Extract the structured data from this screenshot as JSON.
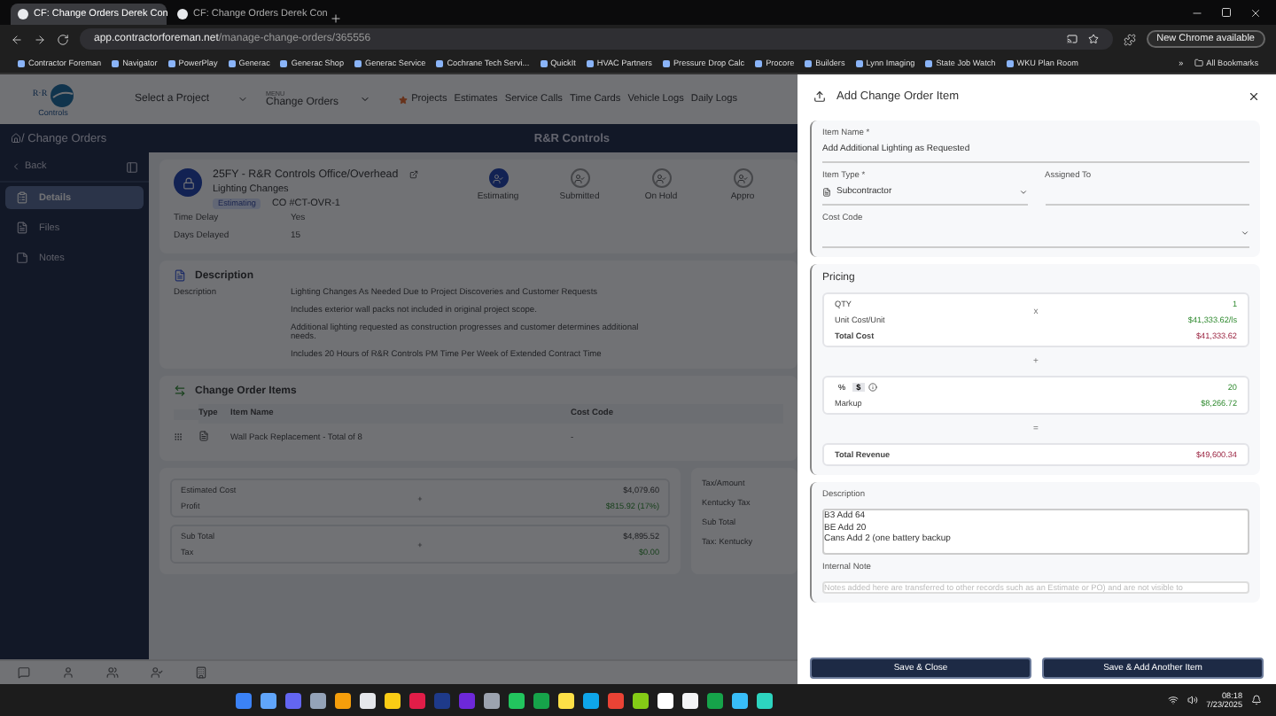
{
  "browser": {
    "tabs": [
      {
        "title": "CF: Change Orders Derek Con",
        "selected": true
      },
      {
        "title": "CF: Change Orders Derek Con",
        "selected": false
      }
    ],
    "url_host": "app.contractorforeman.net",
    "url_path": "/manage-change-orders/365556",
    "update_button": "New Chrome available",
    "bookmarks": [
      "Contractor Foreman",
      "Navigator",
      "PowerPlay",
      "Generac",
      "Generac Shop",
      "Generac Service",
      "Cochrane Tech Servi...",
      "QuickIt",
      "HVAC Partners",
      "Pressure Drop Calc",
      "Procore",
      "Builders",
      "Lynn Imaging",
      "State Job Watch",
      "WKU Plan Room"
    ],
    "more": "»",
    "all_bookmarks": "All Bookmarks"
  },
  "header": {
    "logo_mark": "R·R",
    "logo_text": "Controls",
    "project_select": "Select a Project",
    "menu_label": "MENU",
    "menu_value": "Change Orders",
    "nav": [
      {
        "label": "Projects",
        "starred": true
      },
      {
        "label": "Estimates",
        "starred": false
      },
      {
        "label": "Service Calls",
        "starred": false
      },
      {
        "label": "Time Cards",
        "starred": false
      },
      {
        "label": "Vehicle Logs",
        "starred": false
      },
      {
        "label": "Daily Logs",
        "starred": false
      }
    ]
  },
  "breadcrumb": {
    "separator": "/",
    "page": "Change Orders",
    "company": "R&R Controls"
  },
  "sidebar": {
    "back": "Back",
    "items": [
      {
        "label": "Details",
        "selected": true
      },
      {
        "label": "Files",
        "selected": false
      },
      {
        "label": "Notes",
        "selected": false
      }
    ]
  },
  "record": {
    "title": "25FY - R&R Controls Office/Overhead",
    "subtitle": "Lighting Changes",
    "status": "Estimating",
    "number": "CO #CT-OVR-1",
    "steps": [
      {
        "label": "Estimating",
        "selected": true
      },
      {
        "label": "Submitted",
        "selected": false
      },
      {
        "label": "On Hold",
        "selected": false
      },
      {
        "label": "Appro",
        "selected": false
      }
    ],
    "fields": [
      {
        "label": "Time Delay",
        "value": "Yes"
      },
      {
        "label": "Days Delayed",
        "value": "15"
      }
    ]
  },
  "description": {
    "heading": "Description",
    "label": "Description",
    "paragraphs": [
      "Lighting Changes As Needed Due to Project Discoveries and Customer Requests",
      "Includes exterior wall packs not included in original project scope.",
      "Additional lighting requested as construction progresses and customer determines additional needs.",
      "Includes 20 Hours of R&R Controls PM Time Per Week of Extended Contract Time"
    ]
  },
  "items": {
    "heading": "Change Order Items",
    "columns": [
      "Type",
      "Item Name",
      "Cost Code"
    ],
    "rows": [
      {
        "name": "Wall Pack Replacement - Total of 8",
        "cost_code": "-"
      }
    ]
  },
  "summary": {
    "groups": [
      [
        {
          "label": "Estimated Cost",
          "value": "$4,079.60",
          "positive": false
        },
        {
          "label": "Profit",
          "value": "$815.92 (17%)",
          "positive": true
        }
      ],
      [
        {
          "label": "Sub Total",
          "value": "$4,895.52",
          "positive": false
        },
        {
          "label": "Tax",
          "value": "$0.00",
          "positive": true
        }
      ]
    ],
    "operators": [
      "+",
      "+"
    ],
    "tax_heading": "Tax/Amount",
    "tax_name": "Kentucky Tax",
    "tax_rows": [
      "Sub Total",
      "Tax: Kentucky"
    ]
  },
  "drawer": {
    "title": "Add Change Order Item",
    "item_name_label": "Item Name *",
    "item_name": "Add Additional Lighting as Requested",
    "item_type_label": "Item Type *",
    "item_type": "Subcontractor",
    "assigned_label": "Assigned To",
    "cost_code_label": "Cost Code",
    "pricing": {
      "heading": "Pricing",
      "qty_label": "QTY",
      "qty": "1",
      "times": "x",
      "unit_cost_label": "Unit Cost/Unit",
      "unit_cost": "$41,333.62/ls",
      "total_cost_label": "Total Cost",
      "total_cost": "$41,333.62",
      "plus": "+",
      "markup_modes": [
        {
          "label": "%",
          "selected": false
        },
        {
          "label": "$",
          "selected": true
        }
      ],
      "markup_value": "20",
      "markup_label": "Markup",
      "markup": "$8,266.72",
      "equals": "=",
      "revenue_label": "Total Revenue",
      "revenue": "$49,600.34"
    },
    "description_label": "Description",
    "description": "B3 Add 64\nBE Add 20\nCans Add 2 (one battery backup",
    "note_label": "Internal Note",
    "note_placeholder": "Notes added here are transferred to other records such as an Estimate or PO) and are not visible to",
    "buttons": [
      "Save & Close",
      "Save & Add Another Item"
    ]
  },
  "taskbar": {
    "time": "08:18",
    "date": "7/23/2025"
  }
}
